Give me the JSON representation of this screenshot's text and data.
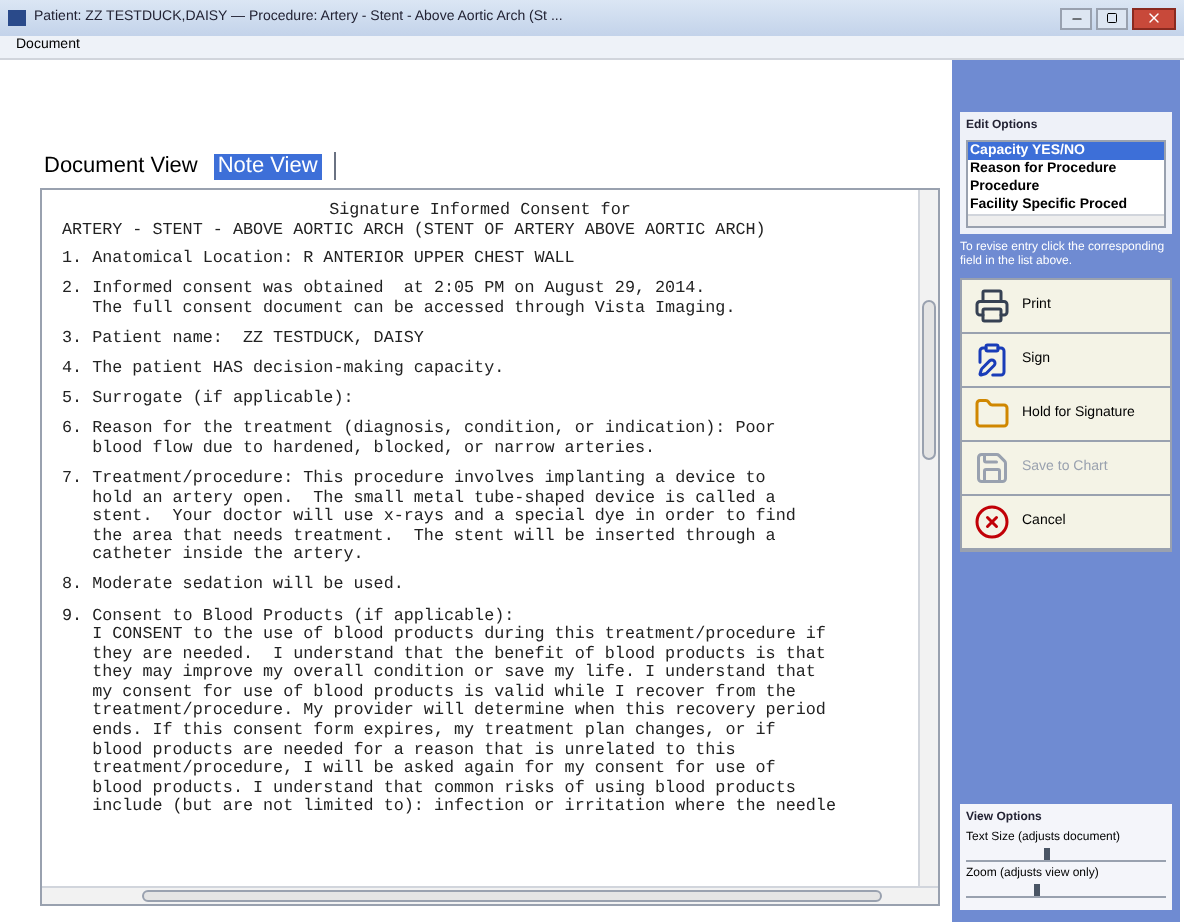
{
  "window": {
    "title": "Patient: ZZ TESTDUCK,DAISY  —  Procedure: Artery - Stent - Above Aortic Arch (St ..."
  },
  "menu": [
    "Document"
  ],
  "tabs": [
    {
      "label": "Document View",
      "selected": false
    },
    {
      "label": "Note View",
      "selected": true
    }
  ],
  "document": {
    "heading": [
      "Signature Informed Consent for",
      "ARTERY - STENT - ABOVE AORTIC ARCH (STENT OF ARTERY ABOVE AORTIC ARCH)"
    ],
    "paragraphs": [
      {
        "lines": [
          "1. Anatomical Location: R ANTERIOR UPPER CHEST WALL"
        ]
      },
      {
        "lines": [
          "2. Informed consent was obtained  at 2:05 PM on August 29, 2014.",
          "   The full consent document can be accessed through Vista Imaging."
        ]
      },
      {
        "lines": [
          "3. Patient name:  ZZ TESTDUCK, DAISY"
        ]
      },
      {
        "lines": [
          "4. The patient HAS decision-making capacity."
        ]
      },
      {
        "lines": [
          "5. Surrogate (if applicable):"
        ]
      },
      {
        "lines": [
          "6. Reason for the treatment (diagnosis, condition, or indication): Poor",
          "   blood flow due to hardened, blocked, or narrow arteries."
        ]
      },
      {
        "lines": [
          "7. Treatment/procedure: This procedure involves implanting a device to",
          "   hold an artery open.  The small metal tube-shaped device is called a",
          "   stent.  Your doctor will use x-rays and a special dye in order to find",
          "   the area that needs treatment.  The stent will be inserted through a",
          "   catheter inside the artery."
        ]
      },
      {
        "lines": [
          "8. Moderate sedation will be used."
        ]
      },
      {
        "lines": [
          "9. Consent to Blood Products (if applicable):",
          "   I CONSENT to the use of blood products during this treatment/procedure if",
          "   they are needed.  I understand that the benefit of blood products is that",
          "   they may improve my overall condition or save my life. I understand that",
          "   my consent for use of blood products is valid while I recover from the",
          "   treatment/procedure. My provider will determine when this recovery period",
          "   ends. If this consent form expires, my treatment plan changes, or if",
          "   blood products are needed for a reason that is unrelated to this",
          "   treatment/procedure, I will be asked again for my consent for use of",
          "   blood products. I understand that common risks of using blood products",
          "   include (but are not limited to): infection or irritation where the needle"
        ]
      }
    ]
  },
  "edit_options": {
    "title": "Edit Options",
    "items": [
      {
        "label": "Capacity YES/NO",
        "selected": true
      },
      {
        "label": "Reason for Procedure",
        "selected": false
      },
      {
        "label": "Procedure",
        "selected": false
      },
      {
        "label": "Facility Specific Proced",
        "selected": false
      }
    ],
    "hint": "To revise entry click the corresponding field in the list above."
  },
  "actions": [
    {
      "kind": "print",
      "label": "Print",
      "disabled": false
    },
    {
      "kind": "sign",
      "label": "Sign",
      "disabled": false
    },
    {
      "kind": "hold",
      "label": "Hold for Signature",
      "disabled": false
    },
    {
      "kind": "save",
      "label": "Save to Chart",
      "disabled": true
    },
    {
      "kind": "cancel",
      "label": "Cancel",
      "disabled": false
    }
  ],
  "view_options": {
    "title": "View Options",
    "sliders": [
      {
        "label": "Text Size  (adjusts document)",
        "level": 0.4
      },
      {
        "label": "Zoom  (adjusts view only)",
        "level": 0.35
      }
    ]
  }
}
